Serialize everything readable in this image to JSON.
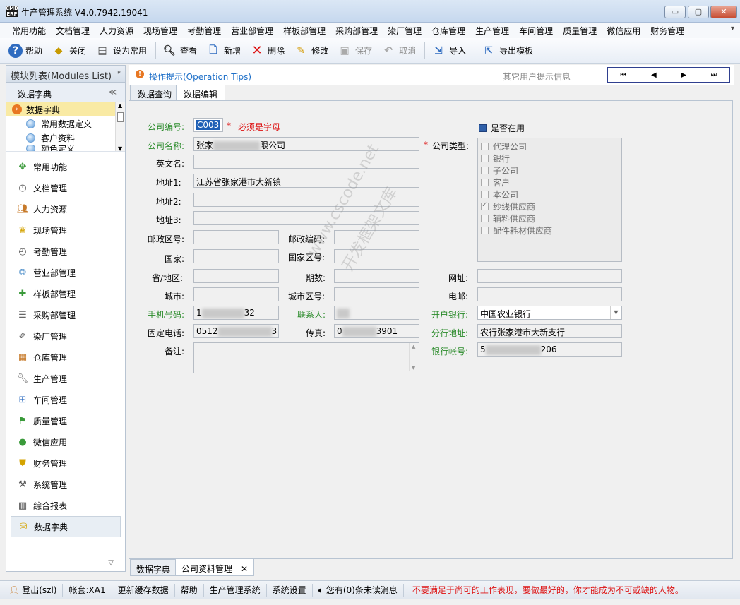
{
  "window": {
    "logo_top": "CMD",
    "logo_bottom": "ERP",
    "title": "生产管理系统 V4.0.7942.19041",
    "btn_min": "▭",
    "btn_max": "▢",
    "btn_close": "✕"
  },
  "menu": {
    "items": [
      "常用功能",
      "文档管理",
      "人力资源",
      "现场管理",
      "考勤管理",
      "营业部管理",
      "样板部管理",
      "采购部管理",
      "染厂管理",
      "仓库管理",
      "生产管理",
      "车间管理",
      "质量管理",
      "微信应用",
      "财务管理"
    ],
    "more": "▾"
  },
  "toolbar": {
    "help": "帮助",
    "close": "关闭",
    "set_common": "设为常用",
    "view": "查看",
    "add": "新增",
    "delete": "删除",
    "edit": "修改",
    "save": "保存",
    "cancel": "取消",
    "import": "导入",
    "export_template": "导出模板"
  },
  "left": {
    "title": "模块列表(Modules List)",
    "pin": "ᵖ",
    "section": "数据字典",
    "collapse": "≪",
    "tree": [
      "数据字典",
      "常用数据定义",
      "客户资料",
      "颜色定义"
    ],
    "modules": [
      "常用功能",
      "文档管理",
      "人力资源",
      "现场管理",
      "考勤管理",
      "营业部管理",
      "样板部管理",
      "采购部管理",
      "染厂管理",
      "仓库管理",
      "生产管理",
      "车间管理",
      "质量管理",
      "微信应用",
      "财务管理",
      "系统管理",
      "综合报表",
      "数据字典"
    ],
    "footer": "▽"
  },
  "tips": {
    "label": "操作提示(Operation Tips)",
    "other": "其它用户提示信息",
    "nav": [
      "⏮",
      "◀",
      "▶",
      "⏭"
    ]
  },
  "tabs": [
    "数据查询",
    "数据编辑"
  ],
  "form": {
    "company_code_label": "公司编号:",
    "company_code": "C003",
    "required_mark": "*",
    "code_hint": "必须是字母",
    "company_name_label": "公司名称:",
    "company_name_prefix": "张家",
    "company_name_suffix": "限公司",
    "english_name_label": "英文名:",
    "address1_label": "地址1:",
    "address1": "江苏省张家港市大新镇",
    "address2_label": "地址2:",
    "address3_label": "地址3:",
    "postal_area_label": "邮政区号:",
    "postal_code_label": "邮政编码:",
    "country_label": "国家:",
    "country_area_label": "国家区号:",
    "province_label": "省/地区:",
    "period_label": "期数:",
    "website_label": "网址:",
    "city_label": "城市:",
    "city_area_label": "城市区号:",
    "email_label": "电邮:",
    "mobile_label": "手机号码:",
    "mobile_prefix": "1",
    "mobile_suffix": "32",
    "contact_label": "联系人:",
    "phone_label": "固定电话:",
    "phone_prefix": "0512",
    "phone_suffix": "3",
    "fax_label": "传真:",
    "fax_prefix": "0",
    "fax_suffix": "3901",
    "remark_label": "备注:",
    "in_use_label": "是否在用",
    "company_type_label": "公司类型:",
    "company_types": [
      {
        "name": "代理公司",
        "checked": false
      },
      {
        "name": "银行",
        "checked": false
      },
      {
        "name": "子公司",
        "checked": false
      },
      {
        "name": "客户",
        "checked": false
      },
      {
        "name": "本公司",
        "checked": false
      },
      {
        "name": "纱线供应商",
        "checked": true
      },
      {
        "name": "辅料供应商",
        "checked": false
      },
      {
        "name": "配件耗材供应商",
        "checked": false
      }
    ],
    "bank_label": "开户银行:",
    "bank": "中国农业银行",
    "branch_label": "分行地址:",
    "branch": "农行张家港市大新支行",
    "account_label": "银行帐号:",
    "account_prefix": "5",
    "account_suffix": "206",
    "watermark1": "www.cscode.net",
    "watermark2": "开发框架文库"
  },
  "doc_tabs": [
    "数据字典",
    "公司资料管理"
  ],
  "doc_tab_close": "✕",
  "status": {
    "logout": "登出(szl)",
    "account": "帐套:XA1",
    "refresh_cache": "更新缓存数据",
    "help": "帮助",
    "system": "生产管理系统",
    "settings": "系统设置",
    "messages": "您有(0)条未读消息",
    "motto": "不要满足于尚可的工作表现，要做最好的，你才能成为不可或缺的人物。"
  },
  "colors": {
    "label_green": "#2a8b2a",
    "required_red": "#dd1111",
    "tips_blue": "#1d6fc8",
    "selection_yellow": "#f9eaa4"
  }
}
